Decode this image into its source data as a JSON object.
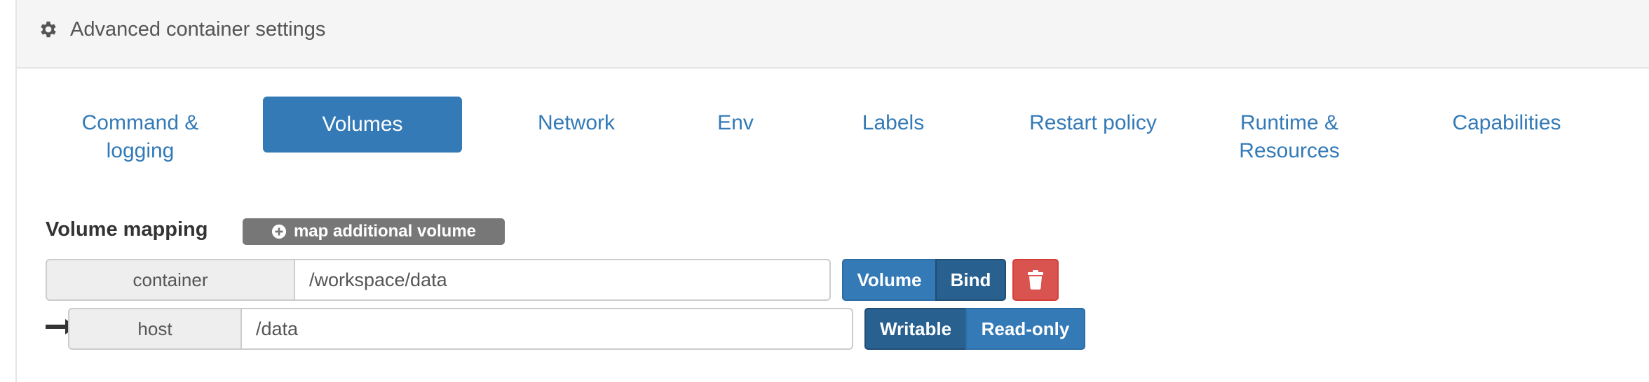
{
  "header": {
    "title": "Advanced container settings",
    "icon": "gear-icon"
  },
  "tabs": [
    {
      "label": "Command & logging",
      "active": false
    },
    {
      "label": "Volumes",
      "active": true
    },
    {
      "label": "Network",
      "active": false
    },
    {
      "label": "Env",
      "active": false
    },
    {
      "label": "Labels",
      "active": false
    },
    {
      "label": "Restart policy",
      "active": false
    },
    {
      "label": "Runtime & Resources",
      "active": false
    },
    {
      "label": "Capabilities",
      "active": false
    }
  ],
  "volumes": {
    "title": "Volume mapping",
    "add_button": "map additional volume",
    "container_row": {
      "addon": "container",
      "value": "/workspace/data",
      "type_options": [
        "Volume",
        "Bind"
      ],
      "selected_type": "Bind"
    },
    "host_row": {
      "addon": "host",
      "value": "/data",
      "mode_options": [
        "Writable",
        "Read-only"
      ],
      "selected_mode": "Writable"
    }
  },
  "colors": {
    "primary": "#337ab7",
    "primary_active": "#286090",
    "danger": "#d9534f",
    "header_bg": "#f5f5f5",
    "badge": "#777777"
  }
}
